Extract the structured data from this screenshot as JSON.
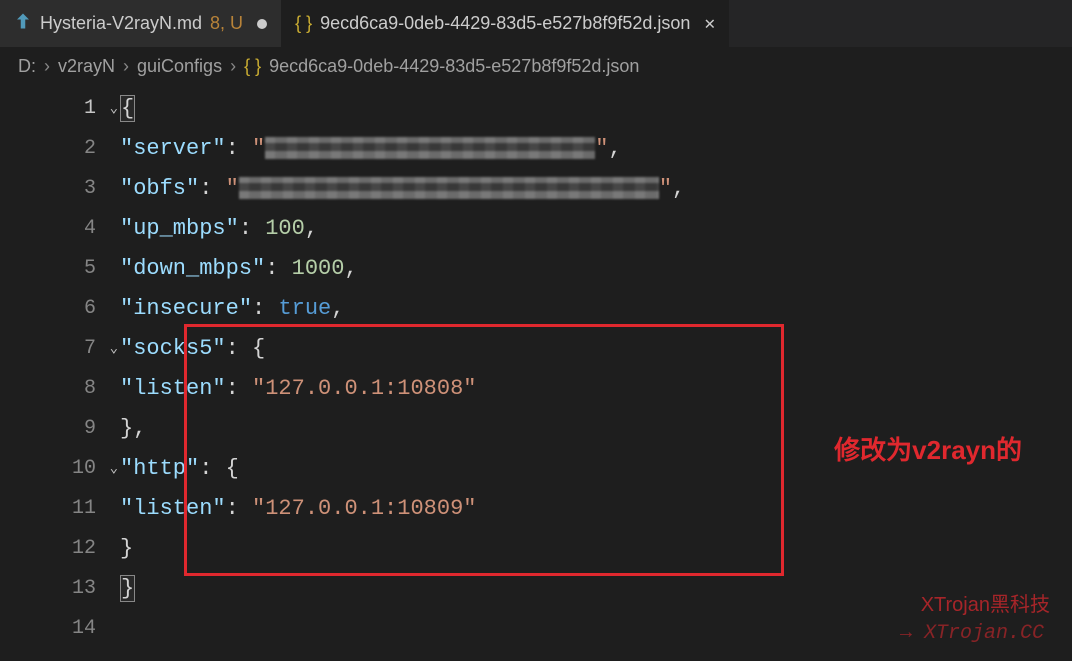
{
  "tabs": {
    "left": {
      "name": "Hysteria-V2rayN.md",
      "badge": "8, U"
    },
    "right": {
      "name": "9ecd6ca9-0deb-4429-83d5-e527b8f9f52d.json"
    }
  },
  "breadcrumb": {
    "drive": "D:",
    "dir1": "v2rayN",
    "dir2": "guiConfigs",
    "file": "9ecd6ca9-0deb-4429-83d5-e527b8f9f52d.json"
  },
  "code": {
    "k_server": "\"server\"",
    "k_obfs": "\"obfs\"",
    "k_up": "\"up_mbps\"",
    "v_up": "100",
    "k_down": "\"down_mbps\"",
    "v_down": "1000",
    "k_insecure": "\"insecure\"",
    "v_insecure": "true",
    "k_socks5": "\"socks5\"",
    "k_listen1": "\"listen\"",
    "v_listen1": "\"127.0.0.1:10808\"",
    "k_http": "\"http\"",
    "k_listen2": "\"listen\"",
    "v_listen2": "\"127.0.0.1:10809\""
  },
  "lines": [
    "1",
    "2",
    "3",
    "4",
    "5",
    "6",
    "7",
    "8",
    "9",
    "10",
    "11",
    "12",
    "13",
    "14"
  ],
  "annotation": "修改为v2rayn的",
  "watermark1": "XTrojan黑科技",
  "watermark2": "→ XTrojan.CC"
}
